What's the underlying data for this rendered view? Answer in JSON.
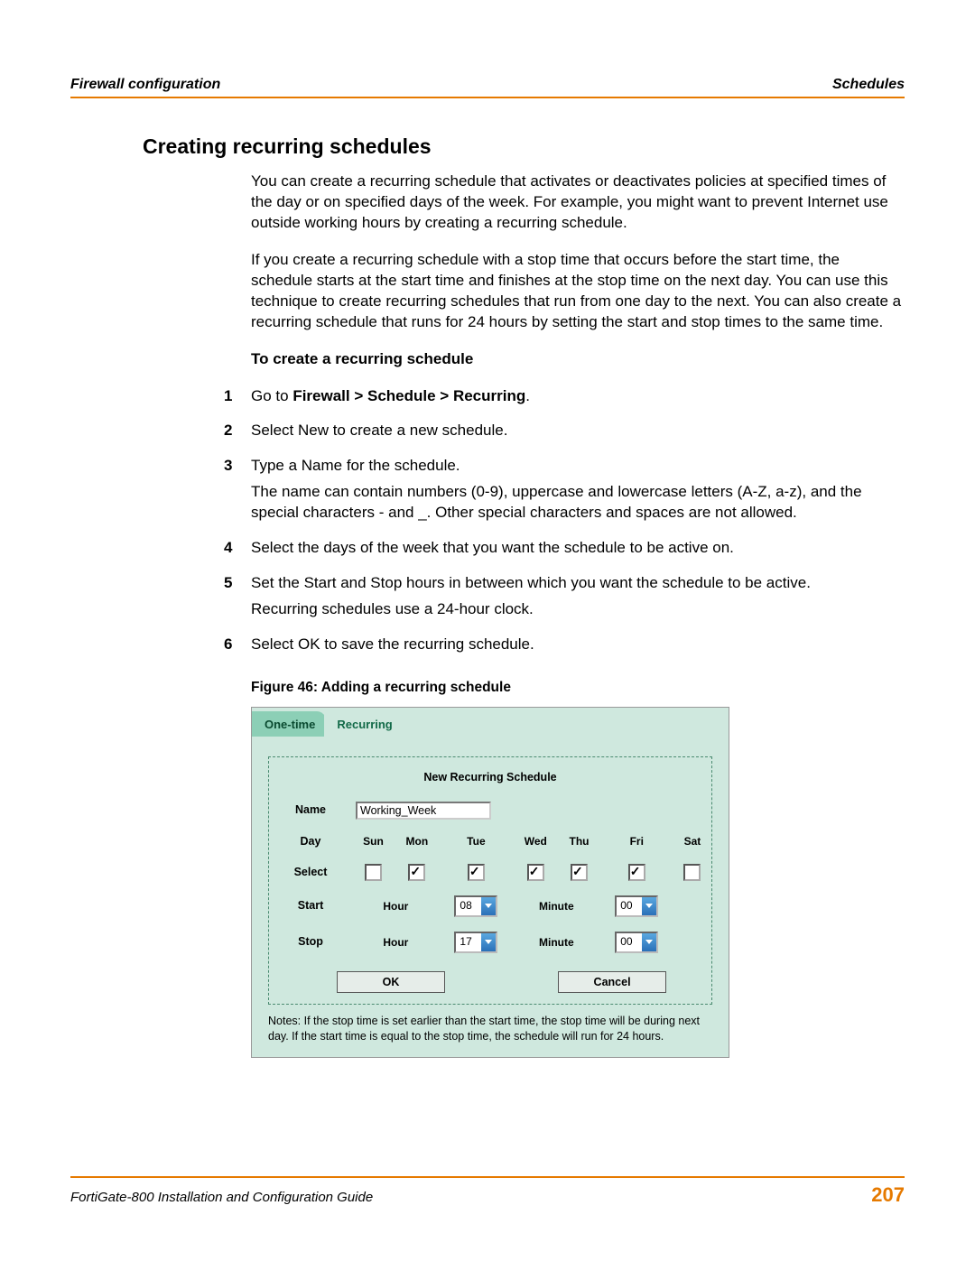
{
  "header": {
    "left": "Firewall configuration",
    "right": "Schedules"
  },
  "section_title": "Creating recurring schedules",
  "para1": "You can create a recurring schedule that activates or deactivates policies at specified times of the day or on specified days of the week. For example, you might want to prevent Internet use outside working hours by creating a recurring schedule.",
  "para2": "If you create a recurring schedule with a stop time that occurs before the start time, the schedule starts at the start time and finishes at the stop time on the next day. You can use this technique to create recurring schedules that run from one day to the next. You can also create a recurring schedule that runs for 24 hours by setting the start and stop times to the same time.",
  "procedure_title": "To create a recurring schedule",
  "steps": [
    {
      "num": "1",
      "lines": [
        "Go to ",
        "Firewall > Schedule > Recurring",
        "."
      ]
    },
    {
      "num": "2",
      "lines": [
        "Select New to create a new schedule."
      ]
    },
    {
      "num": "3",
      "lines": [
        "Type a Name for the schedule.",
        "The name can contain numbers (0-9), uppercase and lowercase letters (A-Z, a-z), and the special characters - and _. Other special characters and spaces are not allowed."
      ]
    },
    {
      "num": "4",
      "lines": [
        "Select the days of the week that you want the schedule to be active on."
      ]
    },
    {
      "num": "5",
      "lines": [
        "Set the Start and Stop hours in between which you want the schedule to be active.",
        "Recurring schedules use a 24-hour clock."
      ]
    },
    {
      "num": "6",
      "lines": [
        "Select OK to save the recurring schedule."
      ]
    }
  ],
  "figure_caption": "Figure 46: Adding a recurring schedule",
  "ui": {
    "tabs": {
      "one_time": "One-time",
      "recurring": "Recurring"
    },
    "panel_title": "New Recurring Schedule",
    "labels": {
      "name": "Name",
      "day": "Day",
      "select": "Select",
      "start": "Start",
      "stop": "Stop",
      "hour": "Hour",
      "minute": "Minute"
    },
    "name_value": "Working_Week",
    "days": [
      "Sun",
      "Mon",
      "Tue",
      "Wed",
      "Thu",
      "Fri",
      "Sat"
    ],
    "day_checked": [
      false,
      true,
      true,
      true,
      true,
      true,
      false
    ],
    "start_hour": "08",
    "start_minute": "00",
    "stop_hour": "17",
    "stop_minute": "00",
    "ok_label": "OK",
    "cancel_label": "Cancel",
    "notes": "Notes: If the stop time is set earlier than the start time, the stop time will be during next day. If the start time is equal to the stop time, the schedule will run for 24 hours."
  },
  "footer": {
    "guide": "FortiGate-800 Installation and Configuration Guide",
    "page_number": "207"
  }
}
